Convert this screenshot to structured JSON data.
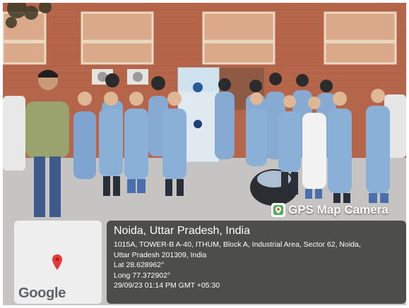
{
  "overlay": {
    "badge_label": "GPS Map Camera",
    "location_title": "Noida, Uttar Pradesh, India",
    "address_line1": "1015A, TOWER-B A-40, ITHUM, Block A, Industrial Area, Sector 62, Noida,",
    "address_line2": "Uttar Pradesh 201309, India",
    "latitude": "Lat 28.628962°",
    "longitude": "Long 77.372902°",
    "timestamp": "29/09/23 01:14 PM GMT +05:30",
    "map_logo": "Google"
  },
  "colors": {
    "brick_wall": "#b5664a",
    "window_frame": "#e9d9c0",
    "uniform_blue": "#8fb1d6",
    "floor": "#c6c4c2",
    "info_panel": "#1e1e1e",
    "map_pin": "#e53935"
  },
  "icons": [
    "gps-map-camera-icon",
    "map-pin-icon"
  ]
}
